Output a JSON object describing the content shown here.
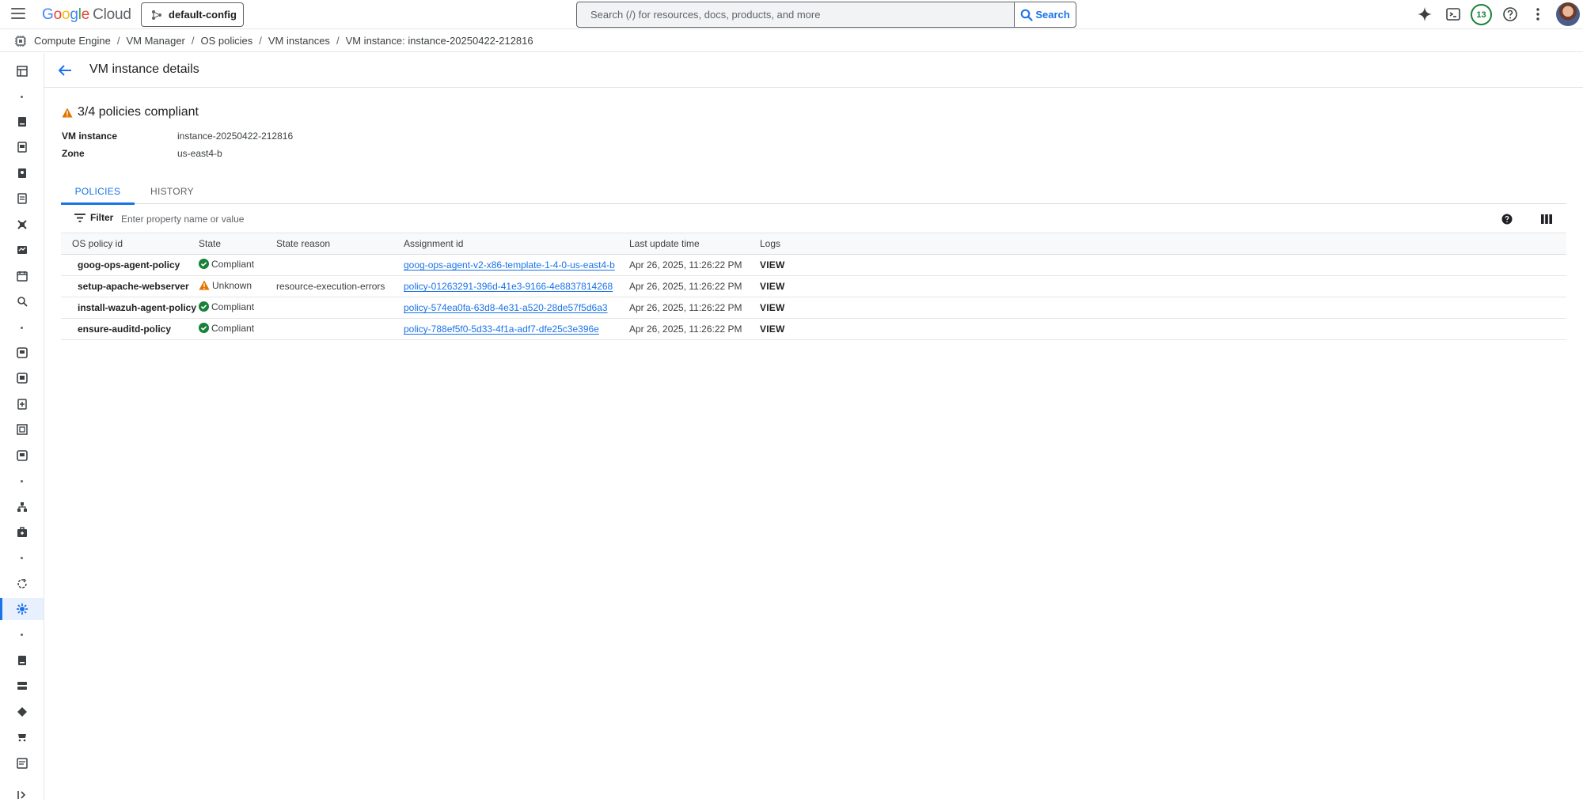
{
  "header": {
    "logo_google": "Google",
    "logo_cloud": "Cloud",
    "project": "default-config",
    "search_placeholder": "Search (/) for resources, docs, products, and more",
    "search_button": "Search",
    "notifications_count": "13"
  },
  "breadcrumb": [
    "Compute Engine",
    "VM Manager",
    "OS policies",
    "VM instances",
    "VM instance: instance-20250422-212816"
  ],
  "page": {
    "title": "VM instance details",
    "summary": "3/4 policies compliant",
    "vm_instance_label": "VM instance",
    "vm_instance_value": "instance-20250422-212816",
    "zone_label": "Zone",
    "zone_value": "us-east4-b"
  },
  "tabs": [
    "POLICIES",
    "HISTORY"
  ],
  "filter": {
    "label": "Filter",
    "placeholder": "Enter property name or value"
  },
  "table": {
    "columns": [
      "OS policy id",
      "State",
      "State reason",
      "Assignment id",
      "Last update time",
      "Logs"
    ],
    "rows": [
      {
        "policy_id": "goog-ops-agent-policy",
        "state": "Compliant",
        "state_reason": "",
        "assignment_id": "goog-ops-agent-v2-x86-template-1-4-0-us-east4-b",
        "updated": "Apr 26, 2025, 11:26:22 PM",
        "logs": "VIEW"
      },
      {
        "policy_id": "setup-apache-webserver",
        "state": "Unknown",
        "state_reason": "resource-execution-errors",
        "assignment_id": "policy-01263291-396d-41e3-9166-4e8837814268",
        "updated": "Apr 26, 2025, 11:26:22 PM",
        "logs": "VIEW"
      },
      {
        "policy_id": "install-wazuh-agent-policy",
        "state": "Compliant",
        "state_reason": "",
        "assignment_id": "policy-574ea0fa-63d8-4e31-a520-28de57f5d6a3",
        "updated": "Apr 26, 2025, 11:26:22 PM",
        "logs": "VIEW"
      },
      {
        "policy_id": "ensure-auditd-policy",
        "state": "Compliant",
        "state_reason": "",
        "assignment_id": "policy-788ef5f0-5d33-4f1a-adf7-dfe25c3e396e",
        "updated": "Apr 26, 2025, 11:26:22 PM",
        "logs": "VIEW"
      }
    ]
  },
  "colors": {
    "accent": "#1a73e8",
    "compliant": "#188038",
    "warning": "#e37400"
  }
}
